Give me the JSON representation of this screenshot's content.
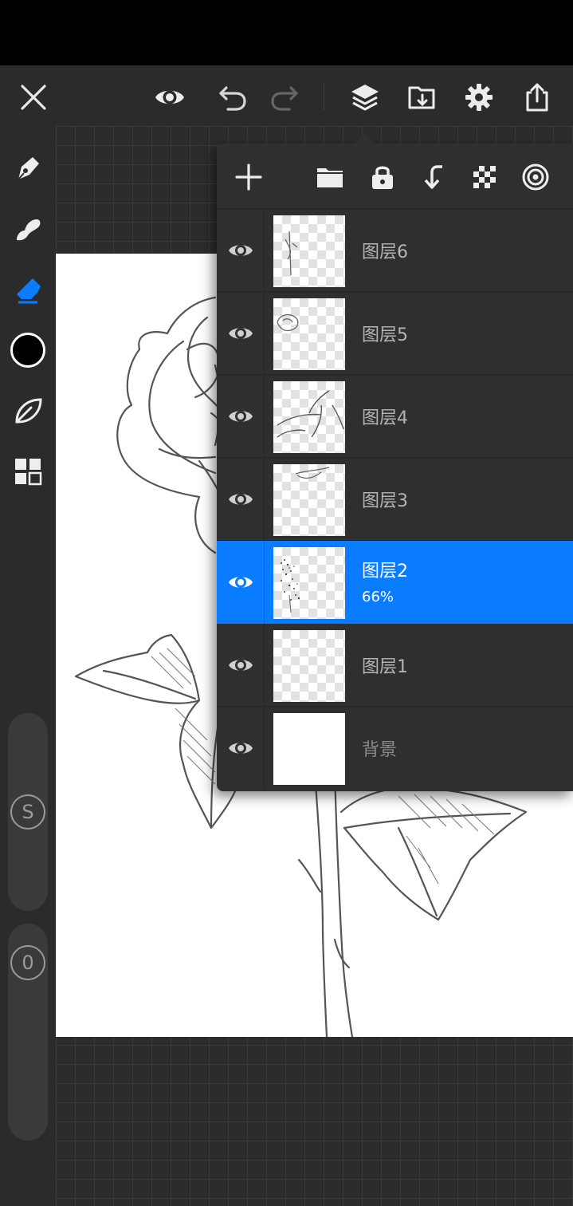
{
  "toolbar": {
    "icons": [
      "close-icon",
      "preview-eye-icon",
      "undo-icon",
      "redo-icon",
      "layers-icon",
      "import-icon",
      "settings-icon",
      "share-icon"
    ]
  },
  "left_toolbar": {
    "tools": [
      "pen-tool-icon",
      "smudge-tool-icon",
      "eraser-tool-icon",
      "color-swatch",
      "leaf-brush-icon",
      "gallery-grid-icon"
    ],
    "active_tool": "eraser",
    "color": "#000000",
    "size_slider_label": "S",
    "opacity_slider_label": "0"
  },
  "layers_panel": {
    "header_icons": [
      "add-layer-icon",
      "folder-icon",
      "lock-icon",
      "merge-down-icon",
      "transparency-checker-icon",
      "blend-mode-icon"
    ],
    "layers": [
      {
        "name": "图层6",
        "visible": true,
        "selected": false
      },
      {
        "name": "图层5",
        "visible": true,
        "selected": false
      },
      {
        "name": "图层4",
        "visible": true,
        "selected": false
      },
      {
        "name": "图层3",
        "visible": true,
        "selected": false
      },
      {
        "name": "图层2",
        "visible": true,
        "selected": true,
        "opacity": "66%"
      },
      {
        "name": "图层1",
        "visible": true,
        "selected": false
      },
      {
        "name": "背景",
        "visible": true,
        "selected": false
      }
    ]
  },
  "colors": {
    "accent": "#0a7cff",
    "toolbar_bg": "#2b2b2b",
    "panel_bg": "#2f2f2f"
  }
}
